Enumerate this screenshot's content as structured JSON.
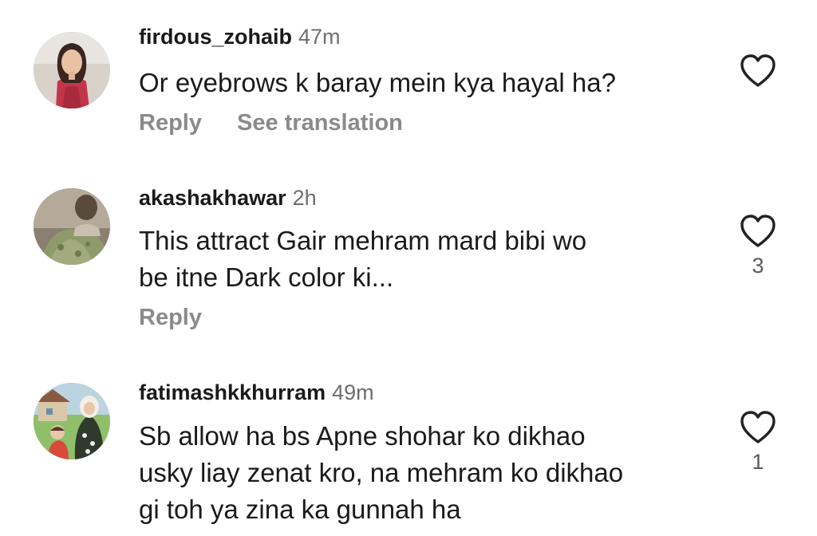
{
  "comments": [
    {
      "username": "firdous_zohaib",
      "time": "47m",
      "lines": [
        "Or eyebrows k baray mein kya hayal ha?"
      ],
      "reply_label": "Reply",
      "translate_label": "See translation",
      "likes": ""
    },
    {
      "username": "akashakhawar",
      "time": "2h",
      "lines": [
        "This attract Gair mehram mard bibi wo",
        "be itne Dark color ki..."
      ],
      "reply_label": "Reply",
      "likes": "3"
    },
    {
      "username": "fatimashkkhurram",
      "time": "49m",
      "lines": [
        "Sb allow ha bs Apne shohar ko dikhao",
        "usky liay zenat kro, na mehram ko dikhao",
        "gi toh ya zina ka gunnah ha"
      ],
      "likes": "1"
    }
  ],
  "icons": {
    "like": "heart-outline-icon"
  },
  "colors": {
    "text": "#1a1a1a",
    "secondary": "#8a8a8a",
    "timestamp": "#6e6e6e"
  }
}
